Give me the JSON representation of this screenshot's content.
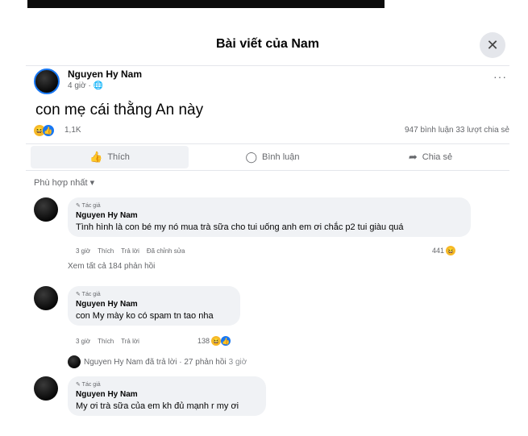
{
  "modal": {
    "title": "Bài viết của Nam",
    "close_icon": "✕"
  },
  "post": {
    "author": "Nguyen Hy Nam",
    "time": "4 giờ · 🌐",
    "more": "···",
    "text": "con mẹ cái thằng An này",
    "reaction_count": "1,1K",
    "comment_share_counts": "947 bình luận   33 lượt chia sẻ"
  },
  "actions": {
    "like": "Thích",
    "comment": "Bình luận",
    "share": "Chia sẻ"
  },
  "sort_label": "Phù hợp nhất ▾",
  "comments": [
    {
      "badge": "✎ Tác giả",
      "author": "Nguyen Hy Nam",
      "text": "Tình hình là con bé my nó mua trà sữa cho tui uống anh em ơi chắc p2 tui giàu quá",
      "time": "3 giờ",
      "like": "Thích",
      "reply": "Trả lời",
      "edited": "Đã chỉnh sửa",
      "reaction_count": "441",
      "view_replies": "Xem tất cả 184 phản hồi"
    },
    {
      "badge": "✎ Tác giả",
      "author": "Nguyen Hy Nam",
      "text": "con My mày ko có spam tn tao nha",
      "time": "3 giờ",
      "like": "Thích",
      "reply": "Trả lời",
      "reaction_count": "138",
      "reply_summary": "Nguyen Hy Nam đã trả lời · 27 phản hồi",
      "reply_time": "3 giờ"
    },
    {
      "badge": "✎ Tác giả",
      "author": "Nguyen Hy Nam",
      "text": "My ơi trà sữa của em kh đủ mạnh r my ơi"
    }
  ]
}
